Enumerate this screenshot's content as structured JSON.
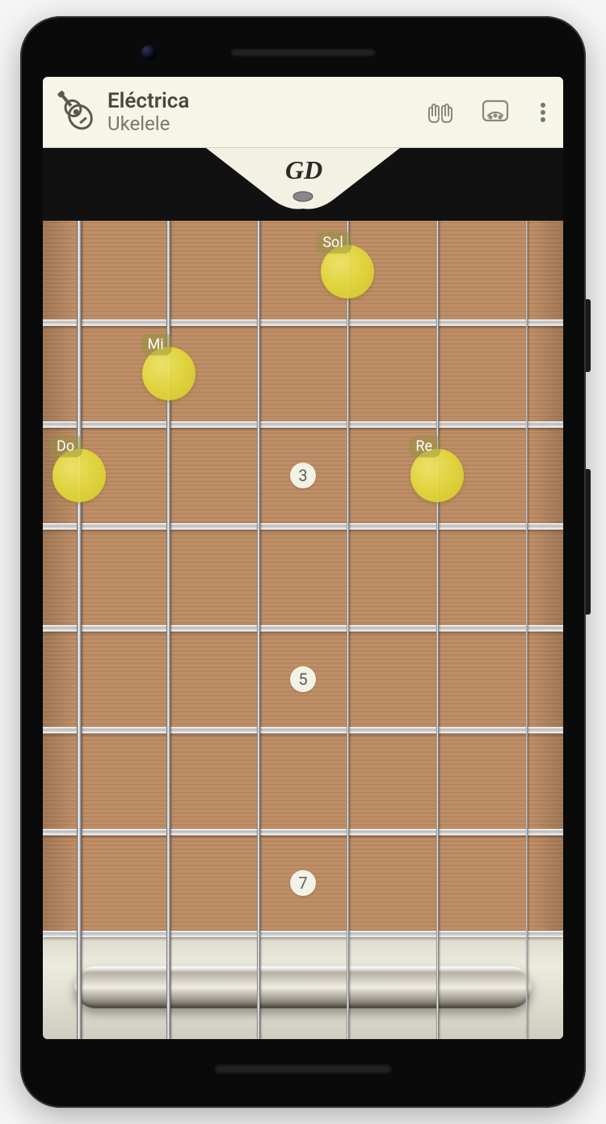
{
  "toolbar": {
    "title": "Eléctrica",
    "subtitle": "Ukelele",
    "icons": {
      "instrument": "guitar-icon",
      "chords": "hands-icon",
      "tuner": "tuner-icon",
      "menu": "more-vert-icon"
    }
  },
  "headstock": {
    "logo_text": "GD"
  },
  "fretboard": {
    "string_count": 6,
    "frets_visible": 7,
    "fret_markers": [
      {
        "fret": 3,
        "label": "3"
      },
      {
        "fret": 5,
        "label": "5"
      },
      {
        "fret": 7,
        "label": "7"
      }
    ],
    "touches": [
      {
        "string": 4,
        "fret": 1,
        "note": "Sol"
      },
      {
        "string": 2,
        "fret": 2,
        "note": "Mi"
      },
      {
        "string": 1,
        "fret": 3,
        "note": "Do"
      },
      {
        "string": 5,
        "fret": 3,
        "note": "Re"
      }
    ]
  },
  "colors": {
    "toolbar_bg": "#f6f6e8",
    "wood": "#b98b63",
    "touch": "#e3d93a",
    "marker": "#f3f2e6"
  }
}
